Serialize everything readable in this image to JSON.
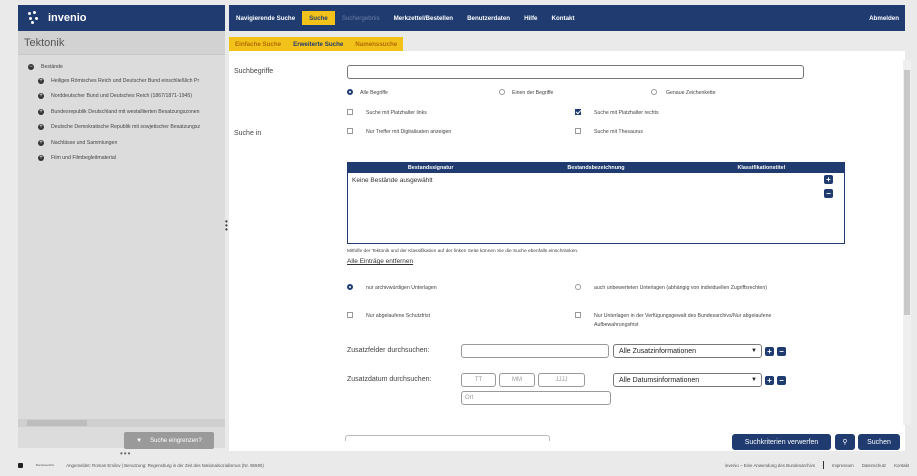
{
  "brand": {
    "name": "invenio",
    "icon": "invenio-dots-logo"
  },
  "left_panel": {
    "title": "Tektonik",
    "root": {
      "label": "Bestände",
      "icon": "collapse-minus-icon"
    },
    "items": [
      {
        "label": "Heiliges Römisches Reich und Deutscher Bund einschließlich Pr"
      },
      {
        "label": "Norddeutscher Bund und Deutsches Reich (1867/1871-1945)"
      },
      {
        "label": "Bundesrepublik Deutschland mit westalliierten Besatzungszonen"
      },
      {
        "label": "Deutsche Demokratische Republik mit sowjetischer Besatzungsz"
      },
      {
        "label": "Nachlässe und Sammlungen"
      },
      {
        "label": "Film und Filmbegleitmaterial"
      }
    ],
    "refine_button": "Suche eingrenzen?",
    "refine_icon": "filter-icon"
  },
  "topnav": {
    "items": [
      {
        "label": "Navigierende Suche",
        "state": "normal"
      },
      {
        "label": "Suche",
        "state": "active"
      },
      {
        "label": "Suchergebnis",
        "state": "disabled"
      },
      {
        "label": "Merkzettel/Bestellen",
        "state": "normal"
      },
      {
        "label": "Benutzerdaten",
        "state": "normal"
      },
      {
        "label": "Hilfe",
        "state": "normal"
      },
      {
        "label": "Kontakt",
        "state": "normal"
      }
    ],
    "logout": "Abmelden"
  },
  "subtabs": [
    {
      "label": "Einfache Suche",
      "active": false
    },
    {
      "label": "Erweiterte Suche",
      "active": true
    },
    {
      "label": "Namenssuche",
      "active": false
    }
  ],
  "form": {
    "suchbegriffe_label": "Suchbegriffe",
    "search_value": "",
    "radio_terms": [
      "Alle Begriffe",
      "Einen der Begriffe",
      "Genaue Zeichenkette"
    ],
    "cb_left_wildcard": "Suche mit Platzhalter links",
    "cb_right_wildcard": "Suche mit Platzhalter rechts",
    "suche_in_label": "Suche in",
    "cb_digital": "Nur Treffer mit Digitalisaten anzeigen",
    "cb_thesaurus": "Suche mit Thesaurus",
    "table": {
      "columns": [
        "Bestandssignatur",
        "Bestandsbezeichnung",
        "Klassifikationstitel"
      ],
      "empty_text": "Keine Bestände ausgewählt"
    },
    "hint": "Mithilfe der Tektonik und der Klassifikation auf der linken Seite können Sie die Suche ebenfalls einschränken.",
    "clear_all_link": "Alle Einträge entfernen",
    "radio_archival": "nur archivwürdigen Unterlagen",
    "radio_unrated": "auch unbewerteten Unterlagen (abhängig von individuellen Zugriffsrechten)",
    "cb_protection": "Nur abgelaufene Schutzfrist",
    "cb_custody_line1": "Nur Unterlagen in der Verfügungsgewalt des Bundesarchivs/Nur abgelaufene",
    "cb_custody_line2": "Aufbewahrungsfrist",
    "zusatzfelder_label": "Zusatzfelder durchsuchen:",
    "zusatz_select": "Alle Zusatzinformationen",
    "zusatzdatum_label": "Zusatzdatum durchsuchen:",
    "date_placeholders": {
      "day": "TT",
      "month": "MM",
      "year": "JJJJ",
      "place": "Ort"
    },
    "datum_select": "Alle Datumsinformationen"
  },
  "bottom": {
    "reset": "Suchkriterien verwerfen",
    "search": "Suchen",
    "search_icon": "search-icon"
  },
  "footer": {
    "logo_text": "Bundesarchiv",
    "status": "Angemeldet: Roman Emilov  |  Benutzung: Regensburg in der Zeit des Nationalsozialismus (Nr. 95590)",
    "app_line": "invenio – Eine Anwendung des Bundesarchivs",
    "links": [
      "Impressum",
      "Datenschutz",
      "Kontakt"
    ]
  }
}
